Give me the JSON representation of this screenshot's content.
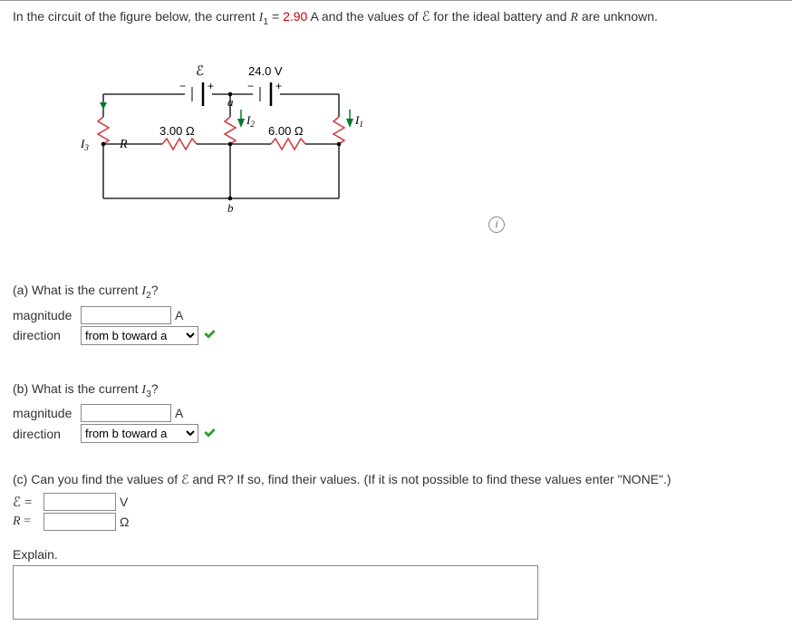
{
  "prompt": {
    "prefix": "In the circuit of the figure below, the current ",
    "I_sym": "I",
    "I_sub": "1",
    "eq": " = ",
    "I1_value": "2.90",
    "unit_A": " A and the values of ",
    "eps_sym": "ℰ",
    "suffix": " for the ideal battery and ",
    "R_sym": "R",
    "suffix2": " are unknown."
  },
  "figure": {
    "eps_label": "ℰ",
    "v24": "24.0 V",
    "minus": "−",
    "plus": "+",
    "node_a": "a",
    "node_b": "b",
    "R_label": "R",
    "r3": "3.00 Ω",
    "r6": "6.00 Ω",
    "I1_label": "I",
    "I1_sub": "1",
    "I2_label": "I",
    "I2_sub": "2",
    "I3_label": "I",
    "I3_sub": "3"
  },
  "info_icon_glyph": "i",
  "partA": {
    "question_prefix": "(a) What is the current ",
    "I_sym": "I",
    "I_sub": "2",
    "question_suffix": "?",
    "magnitude_label": "magnitude",
    "magnitude_unit": "A",
    "direction_label": "direction",
    "direction_option": "from b toward a"
  },
  "partB": {
    "question_prefix": "(b) What is the current ",
    "I_sym": "I",
    "I_sub": "3",
    "question_suffix": "?",
    "magnitude_label": "magnitude",
    "magnitude_unit": "A",
    "direction_label": "direction",
    "direction_option": "from b toward a"
  },
  "partC": {
    "question": "(c) Can you find the values of ℰ and R? If so, find their values. (If it is not possible to find these values enter \"NONE\".)",
    "eps_label": "ℰ =",
    "eps_unit": "V",
    "R_label": "R =",
    "R_unit": "Ω",
    "explain_label": "Explain."
  }
}
